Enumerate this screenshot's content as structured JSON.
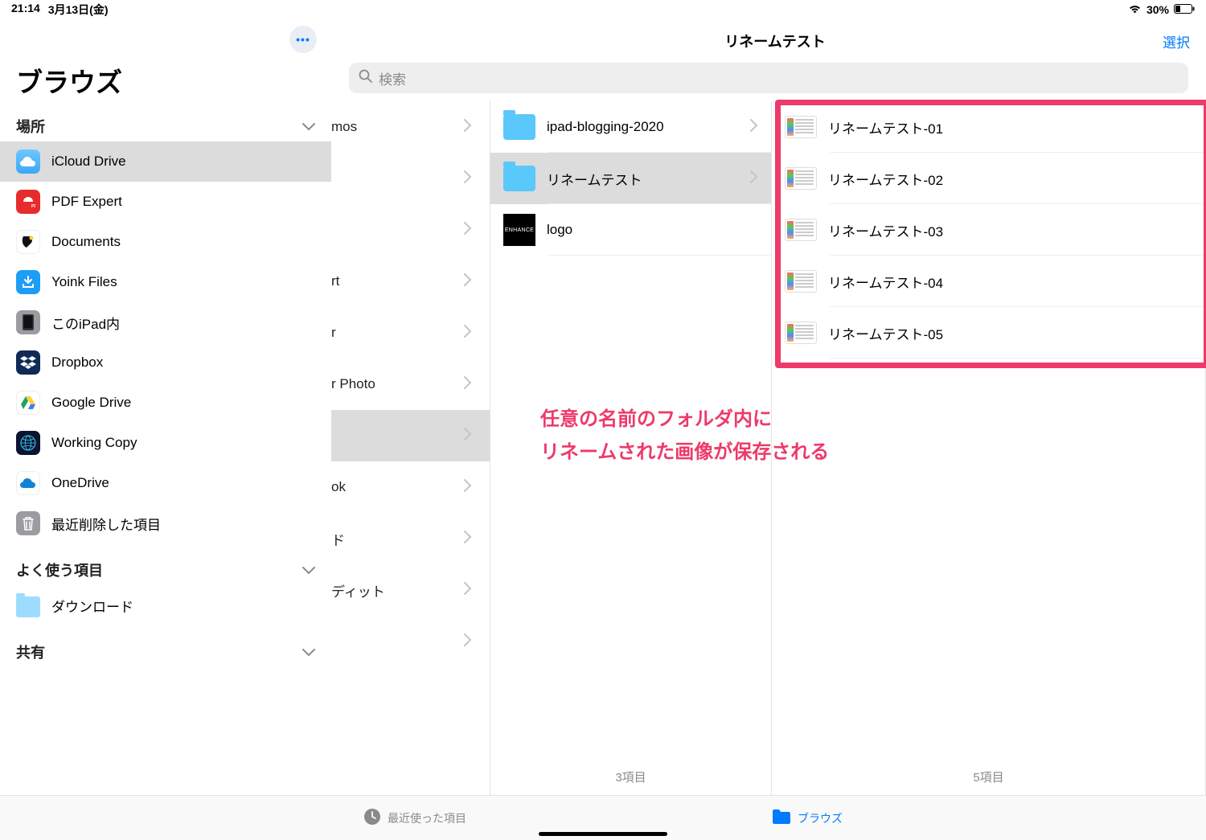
{
  "status": {
    "time": "21:14",
    "date": "3月13日(金)",
    "battery": "30%"
  },
  "sidebar": {
    "title": "ブラウズ",
    "sections": {
      "places": "場所",
      "favorites": "よく使う項目",
      "shared": "共有"
    },
    "items": [
      {
        "label": "iCloud Drive"
      },
      {
        "label": "PDF Expert"
      },
      {
        "label": "Documents"
      },
      {
        "label": "Yoink Files"
      },
      {
        "label": "このiPad内"
      },
      {
        "label": "Dropbox"
      },
      {
        "label": "Google Drive"
      },
      {
        "label": "Working Copy"
      },
      {
        "label": "OneDrive"
      },
      {
        "label": "最近削除した項目"
      }
    ],
    "fav": [
      {
        "label": "ダウンロード"
      }
    ]
  },
  "header": {
    "title": "リネームテスト",
    "select": "選択"
  },
  "search": {
    "placeholder": "検索"
  },
  "col1": {
    "rows": [
      "mos",
      "",
      "",
      "rt",
      "r",
      "r Photo",
      "",
      "ok",
      "ド",
      "ディット",
      ""
    ]
  },
  "col2": {
    "rows": [
      {
        "label": "ipad-blogging-2020",
        "type": "folder"
      },
      {
        "label": "リネームテスト",
        "type": "folder",
        "selected": true
      },
      {
        "label": "logo",
        "type": "logo"
      }
    ],
    "footer": "3項目"
  },
  "col3": {
    "rows": [
      {
        "label": "リネームテスト-01"
      },
      {
        "label": "リネームテスト-02"
      },
      {
        "label": "リネームテスト-03"
      },
      {
        "label": "リネームテスト-04"
      },
      {
        "label": "リネームテスト-05"
      }
    ],
    "footer": "5項目"
  },
  "annotation": {
    "line1": "任意の名前のフォルダ内に",
    "line2": "リネームされた画像が保存される"
  },
  "tabbar": {
    "recent": "最近使った項目",
    "browse": "ブラウズ"
  }
}
